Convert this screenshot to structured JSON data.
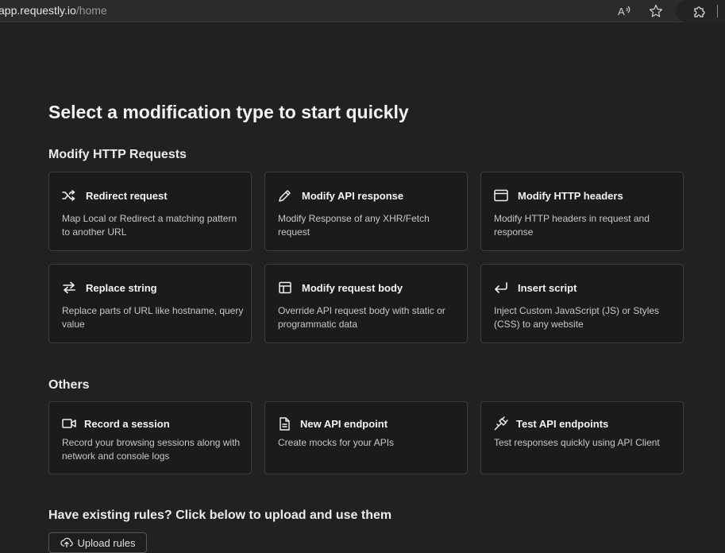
{
  "browser": {
    "url_host": "app.requestly.io",
    "url_path": "/home",
    "icons": [
      "read-aloud-icon",
      "favorite-star-icon",
      "extensions-icon"
    ]
  },
  "page": {
    "title": "Select a modification type to start quickly"
  },
  "sections": {
    "http": {
      "title": "Modify HTTP Requests",
      "cards": [
        {
          "icon": "shuffle-icon",
          "title": "Redirect request",
          "desc": "Map Local or Redirect a matching pattern to another URL"
        },
        {
          "icon": "pencil-icon",
          "title": "Modify API response",
          "desc": "Modify Response of any XHR/Fetch request"
        },
        {
          "icon": "browser-window-icon",
          "title": "Modify HTTP headers",
          "desc": "Modify HTTP headers in request and response"
        },
        {
          "icon": "swap-arrows-icon",
          "title": "Replace string",
          "desc": "Replace parts of URL like hostname, query value"
        },
        {
          "icon": "layout-icon",
          "title": "Modify request body",
          "desc": "Override API request body with static or programmatic data"
        },
        {
          "icon": "enter-arrow-icon",
          "title": "Insert script",
          "desc": "Inject Custom JavaScript (JS) or Styles (CSS) to any website"
        }
      ]
    },
    "others": {
      "title": "Others",
      "cards": [
        {
          "icon": "video-camera-icon",
          "title": "Record a session",
          "desc": "Record your browsing sessions along with network and console logs"
        },
        {
          "icon": "document-icon",
          "title": "New API endpoint",
          "desc": "Create mocks for your APIs"
        },
        {
          "icon": "plug-icon",
          "title": "Test API endpoints",
          "desc": "Test responses quickly using API Client"
        }
      ]
    },
    "upload": {
      "title": "Have existing rules? Click below to upload and use them",
      "button_label": "Upload rules",
      "button_icon": "upload-cloud-icon"
    }
  }
}
